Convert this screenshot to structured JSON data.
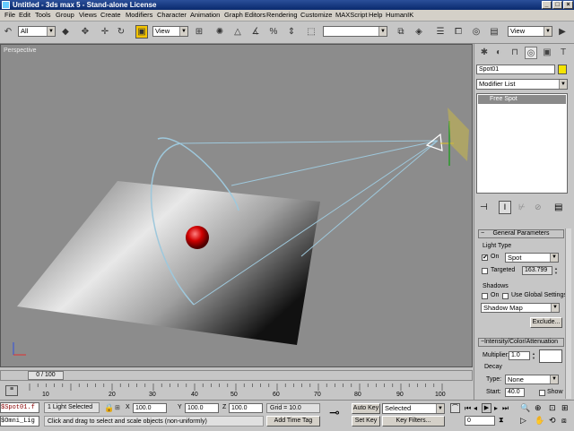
{
  "window": {
    "title": "Untitled - 3ds max 5 - Stand-alone License",
    "min": "_",
    "max": "□",
    "close": "×"
  },
  "menu": [
    "File",
    "Edit",
    "Tools",
    "Group",
    "Views",
    "Create",
    "Modifiers",
    "Character",
    "Animation",
    "Graph Editors",
    "Rendering",
    "Customize",
    "MAXScript",
    "Help",
    "HumanIK"
  ],
  "toolbar": {
    "selection_filter": "All",
    "ref_coord": "View",
    "named_sel": "",
    "view_dropdown_right": "View"
  },
  "viewport": {
    "label": "Perspective"
  },
  "cmd_panel": {
    "object_name": "Spot01",
    "modifier_list": "Modifier List",
    "stack_item": "Free Spot",
    "general_params": {
      "title": "General Parameters",
      "light_type_label": "Light Type",
      "on_label": "On",
      "on_checked": "✔",
      "type_value": "Spot",
      "targeted_label": "Targeted",
      "targeted_value": "163.799",
      "shadows_label": "Shadows",
      "shadows_on_label": "On",
      "use_global_label": "Use Global Settings",
      "shadow_type": "Shadow Map",
      "exclude_label": "Exclude..."
    },
    "intensity": {
      "title": "Intensity/Color/Attenuation",
      "multiplier_label": "Multiplier:",
      "multiplier_value": "1.0",
      "decay_label": "Decay",
      "type_label": "Type:",
      "type_value": "None",
      "start_label": "Start:",
      "start_value": "40.0",
      "show_label": "Show"
    }
  },
  "timeline": {
    "frame": "0 / 100",
    "ticks": [
      "0",
      "10",
      "20",
      "30",
      "40",
      "50",
      "60",
      "70",
      "80",
      "90",
      "100"
    ]
  },
  "status": {
    "script_line1": "$Spot01.f",
    "script_line2": "$Omni_Lig",
    "selection": "1 Light Selected",
    "prompt": "Click and drag to select and scale objects (non-uniformly)",
    "x_label": "X",
    "x_value": "100.0",
    "y_label": "Y",
    "y_value": "100.0",
    "z_label": "Z",
    "z_value": "100.0",
    "grid": "Grid = 10.0",
    "add_time_tag": "Add Time Tag",
    "auto_key": "Auto Key",
    "set_key": "Set Key",
    "key_mode": "Selected",
    "key_filters": "Key Filters...",
    "frame_field": "0"
  },
  "colors": {
    "accent": "#f4c400",
    "viewport_bg": "#8c8c8c",
    "sphere": "#c00000"
  }
}
